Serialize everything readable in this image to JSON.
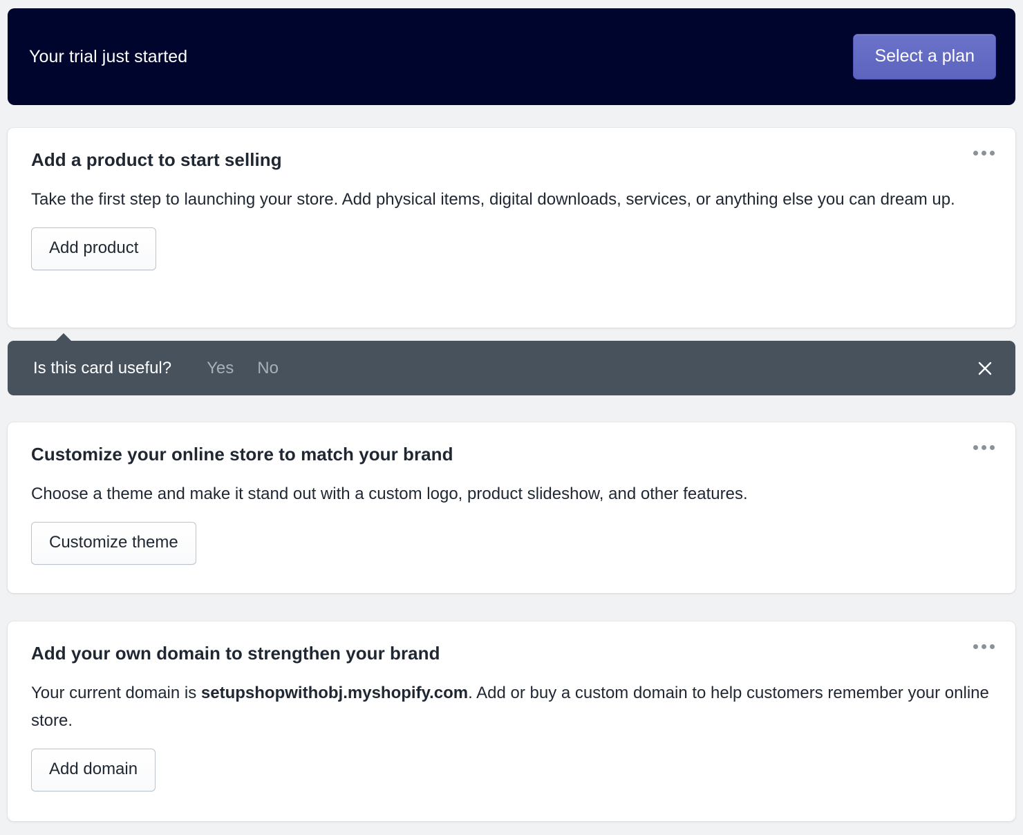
{
  "banner": {
    "message": "Your trial just started",
    "cta_label": "Select a plan",
    "background_color": "#00052e",
    "cta_color": "#5c64bf"
  },
  "feedback": {
    "question": "Is this card useful?",
    "yes_label": "Yes",
    "no_label": "No",
    "close_icon": "close-icon",
    "background_color": "#47525d"
  },
  "cards": [
    {
      "title": "Add a product to start selling",
      "body_before": "Take the first step to launching your store. Add physical items, digital downloads, services, or anything else you can dream up.",
      "body_strong": "",
      "body_after": "",
      "action_label": "Add product",
      "menu_icon": "ellipsis-icon"
    },
    {
      "title": "Customize your online store to match your brand",
      "body_before": "Choose a theme and make it stand out with a custom logo, product slideshow, and other features.",
      "body_strong": "",
      "body_after": "",
      "action_label": "Customize theme",
      "menu_icon": "ellipsis-icon"
    },
    {
      "title": "Add your own domain to strengthen your brand",
      "body_before": "Your current domain is ",
      "body_strong": "setupshopwithobj.myshopify.com",
      "body_after": ". Add or buy a custom domain to help customers remember your online store.",
      "action_label": "Add domain",
      "menu_icon": "ellipsis-icon"
    }
  ]
}
